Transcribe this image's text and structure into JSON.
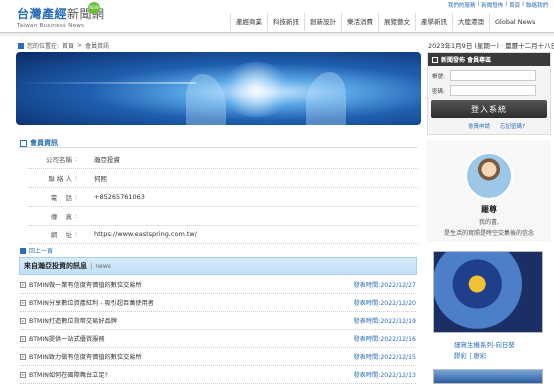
{
  "header": {
    "logo_main": "台灣產經",
    "logo_main2": "新聞網",
    "logo_sub": "Taiwan Business News",
    "badge": "NEW",
    "toplinks": [
      "我們的服務",
      "新聞發佈",
      "首頁",
      "聯絡我們"
    ],
    "nav": [
      "產經商業",
      "科技新訊",
      "創新設計",
      "樂活消費",
      "展覽藝文",
      "產學新訊",
      "大陸港澳",
      "Global News"
    ]
  },
  "breadcrumb": {
    "prefix": "您的位置在:",
    "home": "首頁",
    "current": "會員資訊"
  },
  "date": "2023年1月9日 (星期一) · 農曆十二月十八日",
  "member": {
    "title": "會員資訊",
    "rows": [
      {
        "label": "公司名稱",
        "value": "瀚亞投資"
      },
      {
        "label": "聯 絡 人",
        "value": "何熙"
      },
      {
        "label": "電    話",
        "value": "+85265761063"
      },
      {
        "label": "傳    真",
        "value": ""
      },
      {
        "label": "網    址",
        "value": "https://www.eastspring.com.tw/"
      }
    ]
  },
  "back_link": "回上一頁",
  "news": {
    "title": "來自瀚亞投資的訊息",
    "tag": "news",
    "items": [
      {
        "title": "BTMIN做一業有信度有價值的數位交易所",
        "date": "發表時間:2022/12/27"
      },
      {
        "title": "BTMIN分享數位資產紅利 - 吸引超百萬使用者",
        "date": "發表時間:2022/12/20"
      },
      {
        "title": "BTMIN打造數位貨幣交易好品牌",
        "date": "發表時間:2022/12/19"
      },
      {
        "title": "BTMIN提供一站式優質服務",
        "date": "發表時間:2022/12/16"
      },
      {
        "title": "BTMIN致力做有信度有價值的數位交易所",
        "date": "發表時間:2022/12/15"
      },
      {
        "title": "BTMIN如何在國際舞台立足?",
        "date": "發表時間:2022/12/13"
      }
    ]
  },
  "login": {
    "tab": "新聞發佈 會員專區",
    "account_label": "帳號:",
    "password_label": "密碼:",
    "button": "登入系統",
    "join": "會員申請",
    "forgot": "忘記密碼?"
  },
  "profile": {
    "name": "羅尊",
    "line1": "我的書,",
    "line2": "是生活的寫照是時空交集後的信念"
  },
  "art": {
    "title": "細寫生機系列-向日葵",
    "subtitle": "膠彩 | 廖彩"
  }
}
